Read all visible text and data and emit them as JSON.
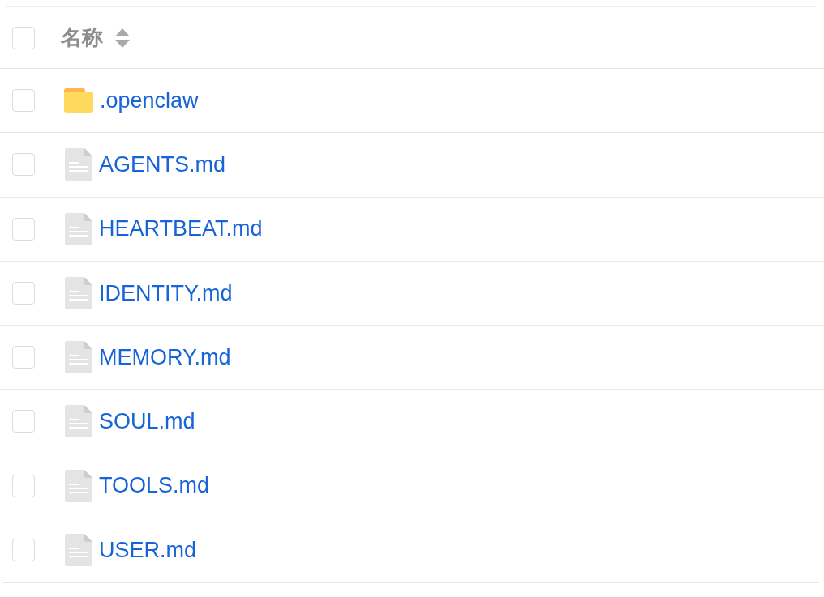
{
  "table": {
    "select_all": {
      "checked": false
    },
    "columns": [
      {
        "label": "名称",
        "sortable": true
      }
    ],
    "rows": [
      {
        "name": ".openclaw",
        "kind": "folder",
        "checked": false
      },
      {
        "name": "AGENTS.md",
        "kind": "file",
        "checked": false
      },
      {
        "name": "HEARTBEAT.md",
        "kind": "file",
        "checked": false
      },
      {
        "name": "IDENTITY.md",
        "kind": "file",
        "checked": false
      },
      {
        "name": "MEMORY.md",
        "kind": "file",
        "checked": false
      },
      {
        "name": "SOUL.md",
        "kind": "file",
        "checked": false
      },
      {
        "name": "TOOLS.md",
        "kind": "file",
        "checked": false
      },
      {
        "name": "USER.md",
        "kind": "file",
        "checked": false
      }
    ]
  }
}
